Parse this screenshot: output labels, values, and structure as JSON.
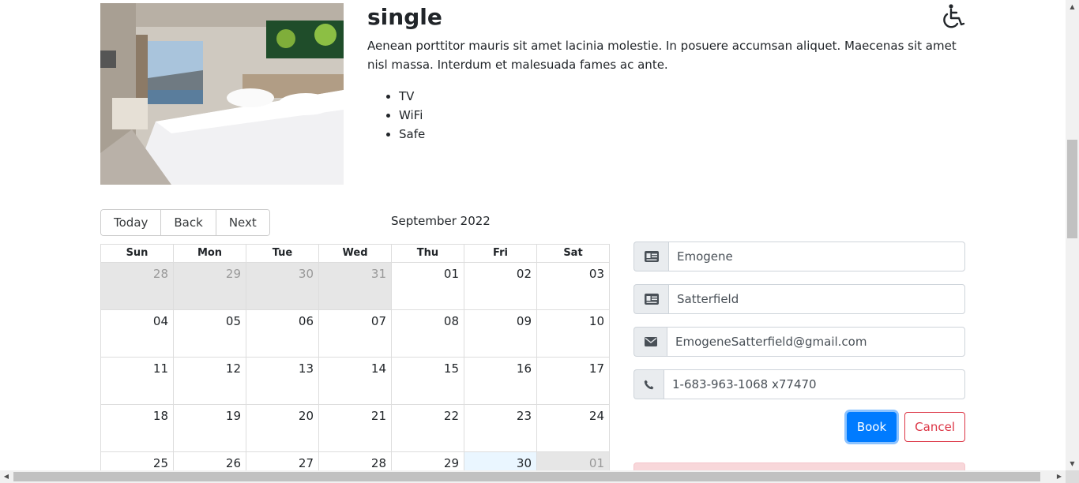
{
  "room": {
    "title": "single",
    "description": "Aenean porttitor mauris sit amet lacinia molestie. In posuere accumsan aliquet. Maecenas sit amet nisl massa. Interdum et malesuada fames ac ante.",
    "amenities": [
      "TV",
      "WiFi",
      "Safe"
    ],
    "accessibility_icon": "wheelchair-icon"
  },
  "calendar": {
    "toolbar": {
      "today": "Today",
      "back": "Back",
      "next": "Next"
    },
    "month_label": "September 2022",
    "weekdays": [
      "Sun",
      "Mon",
      "Tue",
      "Wed",
      "Thu",
      "Fri",
      "Sat"
    ],
    "weeks": [
      [
        {
          "d": "28",
          "off": true
        },
        {
          "d": "29",
          "off": true
        },
        {
          "d": "30",
          "off": true
        },
        {
          "d": "31",
          "off": true
        },
        {
          "d": "01"
        },
        {
          "d": "02"
        },
        {
          "d": "03"
        }
      ],
      [
        {
          "d": "04"
        },
        {
          "d": "05"
        },
        {
          "d": "06"
        },
        {
          "d": "07"
        },
        {
          "d": "08"
        },
        {
          "d": "09"
        },
        {
          "d": "10"
        }
      ],
      [
        {
          "d": "11"
        },
        {
          "d": "12"
        },
        {
          "d": "13"
        },
        {
          "d": "14"
        },
        {
          "d": "15"
        },
        {
          "d": "16"
        },
        {
          "d": "17"
        }
      ],
      [
        {
          "d": "18"
        },
        {
          "d": "19"
        },
        {
          "d": "20"
        },
        {
          "d": "21"
        },
        {
          "d": "22"
        },
        {
          "d": "23"
        },
        {
          "d": "24"
        }
      ],
      [
        {
          "d": "25"
        },
        {
          "d": "26"
        },
        {
          "d": "27"
        },
        {
          "d": "28"
        },
        {
          "d": "29"
        },
        {
          "d": "30",
          "today": true
        },
        {
          "d": "01",
          "off": true
        }
      ]
    ]
  },
  "form": {
    "firstname": {
      "value": "Emogene",
      "icon": "id-card-icon"
    },
    "lastname": {
      "value": "Satterfield",
      "icon": "id-card-icon"
    },
    "email": {
      "value": "EmogeneSatterfield@gmail.com",
      "icon": "envelope-icon"
    },
    "phone": {
      "value": "1-683-963-1068 x77470",
      "icon": "phone-icon"
    },
    "book_label": "Book",
    "cancel_label": "Cancel"
  },
  "colors": {
    "primary": "#007bff",
    "danger": "#dc3545",
    "today_bg": "#eaf6ff",
    "off_range_bg": "#e6e6e6",
    "alert_bg": "#f8d7da"
  }
}
